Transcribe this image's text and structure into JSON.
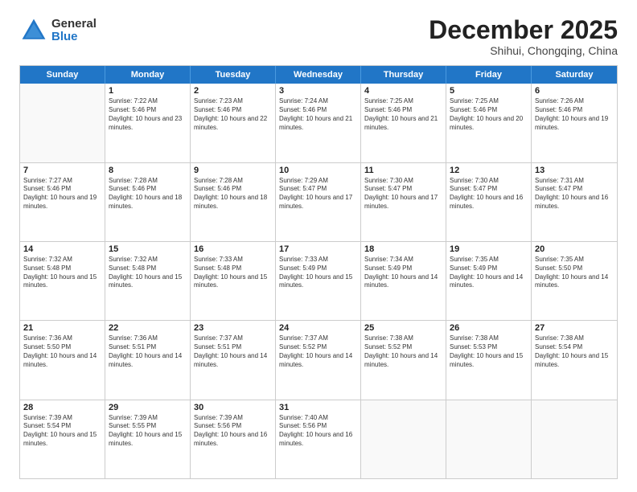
{
  "logo": {
    "general": "General",
    "blue": "Blue"
  },
  "title": "December 2025",
  "subtitle": "Shihui, Chongqing, China",
  "days": [
    "Sunday",
    "Monday",
    "Tuesday",
    "Wednesday",
    "Thursday",
    "Friday",
    "Saturday"
  ],
  "rows": [
    [
      {
        "day": "",
        "empty": true
      },
      {
        "day": "1",
        "sunrise": "Sunrise: 7:22 AM",
        "sunset": "Sunset: 5:46 PM",
        "daylight": "Daylight: 10 hours and 23 minutes."
      },
      {
        "day": "2",
        "sunrise": "Sunrise: 7:23 AM",
        "sunset": "Sunset: 5:46 PM",
        "daylight": "Daylight: 10 hours and 22 minutes."
      },
      {
        "day": "3",
        "sunrise": "Sunrise: 7:24 AM",
        "sunset": "Sunset: 5:46 PM",
        "daylight": "Daylight: 10 hours and 21 minutes."
      },
      {
        "day": "4",
        "sunrise": "Sunrise: 7:25 AM",
        "sunset": "Sunset: 5:46 PM",
        "daylight": "Daylight: 10 hours and 21 minutes."
      },
      {
        "day": "5",
        "sunrise": "Sunrise: 7:25 AM",
        "sunset": "Sunset: 5:46 PM",
        "daylight": "Daylight: 10 hours and 20 minutes."
      },
      {
        "day": "6",
        "sunrise": "Sunrise: 7:26 AM",
        "sunset": "Sunset: 5:46 PM",
        "daylight": "Daylight: 10 hours and 19 minutes."
      }
    ],
    [
      {
        "day": "7",
        "sunrise": "Sunrise: 7:27 AM",
        "sunset": "Sunset: 5:46 PM",
        "daylight": "Daylight: 10 hours and 19 minutes."
      },
      {
        "day": "8",
        "sunrise": "Sunrise: 7:28 AM",
        "sunset": "Sunset: 5:46 PM",
        "daylight": "Daylight: 10 hours and 18 minutes."
      },
      {
        "day": "9",
        "sunrise": "Sunrise: 7:28 AM",
        "sunset": "Sunset: 5:46 PM",
        "daylight": "Daylight: 10 hours and 18 minutes."
      },
      {
        "day": "10",
        "sunrise": "Sunrise: 7:29 AM",
        "sunset": "Sunset: 5:47 PM",
        "daylight": "Daylight: 10 hours and 17 minutes."
      },
      {
        "day": "11",
        "sunrise": "Sunrise: 7:30 AM",
        "sunset": "Sunset: 5:47 PM",
        "daylight": "Daylight: 10 hours and 17 minutes."
      },
      {
        "day": "12",
        "sunrise": "Sunrise: 7:30 AM",
        "sunset": "Sunset: 5:47 PM",
        "daylight": "Daylight: 10 hours and 16 minutes."
      },
      {
        "day": "13",
        "sunrise": "Sunrise: 7:31 AM",
        "sunset": "Sunset: 5:47 PM",
        "daylight": "Daylight: 10 hours and 16 minutes."
      }
    ],
    [
      {
        "day": "14",
        "sunrise": "Sunrise: 7:32 AM",
        "sunset": "Sunset: 5:48 PM",
        "daylight": "Daylight: 10 hours and 15 minutes."
      },
      {
        "day": "15",
        "sunrise": "Sunrise: 7:32 AM",
        "sunset": "Sunset: 5:48 PM",
        "daylight": "Daylight: 10 hours and 15 minutes."
      },
      {
        "day": "16",
        "sunrise": "Sunrise: 7:33 AM",
        "sunset": "Sunset: 5:48 PM",
        "daylight": "Daylight: 10 hours and 15 minutes."
      },
      {
        "day": "17",
        "sunrise": "Sunrise: 7:33 AM",
        "sunset": "Sunset: 5:49 PM",
        "daylight": "Daylight: 10 hours and 15 minutes."
      },
      {
        "day": "18",
        "sunrise": "Sunrise: 7:34 AM",
        "sunset": "Sunset: 5:49 PM",
        "daylight": "Daylight: 10 hours and 14 minutes."
      },
      {
        "day": "19",
        "sunrise": "Sunrise: 7:35 AM",
        "sunset": "Sunset: 5:49 PM",
        "daylight": "Daylight: 10 hours and 14 minutes."
      },
      {
        "day": "20",
        "sunrise": "Sunrise: 7:35 AM",
        "sunset": "Sunset: 5:50 PM",
        "daylight": "Daylight: 10 hours and 14 minutes."
      }
    ],
    [
      {
        "day": "21",
        "sunrise": "Sunrise: 7:36 AM",
        "sunset": "Sunset: 5:50 PM",
        "daylight": "Daylight: 10 hours and 14 minutes."
      },
      {
        "day": "22",
        "sunrise": "Sunrise: 7:36 AM",
        "sunset": "Sunset: 5:51 PM",
        "daylight": "Daylight: 10 hours and 14 minutes."
      },
      {
        "day": "23",
        "sunrise": "Sunrise: 7:37 AM",
        "sunset": "Sunset: 5:51 PM",
        "daylight": "Daylight: 10 hours and 14 minutes."
      },
      {
        "day": "24",
        "sunrise": "Sunrise: 7:37 AM",
        "sunset": "Sunset: 5:52 PM",
        "daylight": "Daylight: 10 hours and 14 minutes."
      },
      {
        "day": "25",
        "sunrise": "Sunrise: 7:38 AM",
        "sunset": "Sunset: 5:52 PM",
        "daylight": "Daylight: 10 hours and 14 minutes."
      },
      {
        "day": "26",
        "sunrise": "Sunrise: 7:38 AM",
        "sunset": "Sunset: 5:53 PM",
        "daylight": "Daylight: 10 hours and 15 minutes."
      },
      {
        "day": "27",
        "sunrise": "Sunrise: 7:38 AM",
        "sunset": "Sunset: 5:54 PM",
        "daylight": "Daylight: 10 hours and 15 minutes."
      }
    ],
    [
      {
        "day": "28",
        "sunrise": "Sunrise: 7:39 AM",
        "sunset": "Sunset: 5:54 PM",
        "daylight": "Daylight: 10 hours and 15 minutes."
      },
      {
        "day": "29",
        "sunrise": "Sunrise: 7:39 AM",
        "sunset": "Sunset: 5:55 PM",
        "daylight": "Daylight: 10 hours and 15 minutes."
      },
      {
        "day": "30",
        "sunrise": "Sunrise: 7:39 AM",
        "sunset": "Sunset: 5:56 PM",
        "daylight": "Daylight: 10 hours and 16 minutes."
      },
      {
        "day": "31",
        "sunrise": "Sunrise: 7:40 AM",
        "sunset": "Sunset: 5:56 PM",
        "daylight": "Daylight: 10 hours and 16 minutes."
      },
      {
        "day": "",
        "empty": true
      },
      {
        "day": "",
        "empty": true
      },
      {
        "day": "",
        "empty": true
      }
    ]
  ]
}
